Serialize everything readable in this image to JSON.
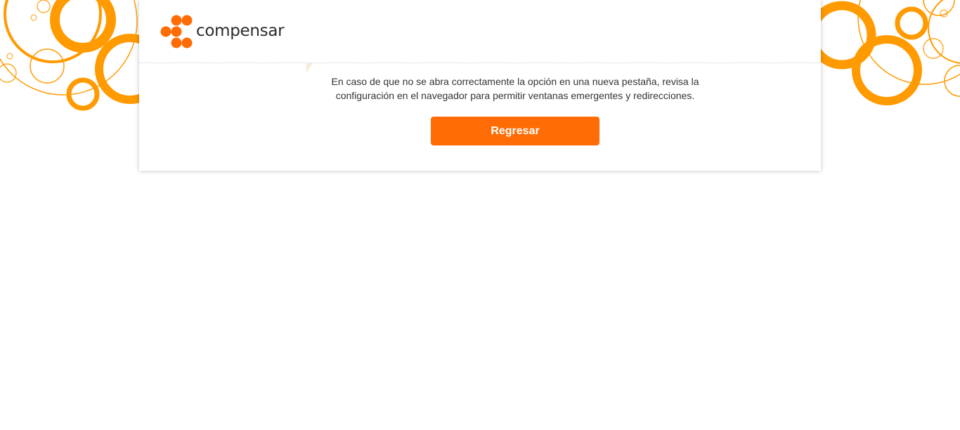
{
  "brand": {
    "name": "compensar",
    "primary_color": "#ff6c05",
    "decoration_color": "#ff9a00"
  },
  "content": {
    "message": "En caso de que no se abra correctamente la opción en una nueva pestaña, revisa la configuración en el navegador para permitir ventanas emergentes y redirecciones.",
    "back_button_label": "Regresar"
  },
  "icons": {
    "logo_mark": "compensar-dots-logo-icon",
    "left_decoration": "orange-circles-decoration-icon",
    "right_decoration": "orange-circles-decoration-icon"
  }
}
